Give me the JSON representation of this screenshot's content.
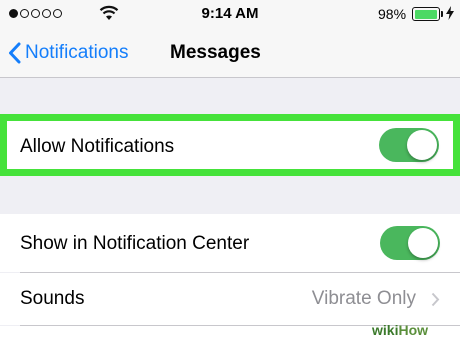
{
  "status_bar": {
    "signal_bars": 5,
    "signal_filled": 1,
    "time": "9:14 AM",
    "battery_percent": "98%",
    "battery_level": 0.98,
    "battery_color": "#4cd964"
  },
  "nav": {
    "back_label": "Notifications",
    "title": "Messages",
    "accent_color": "#147efb"
  },
  "settings": {
    "allow_notifications": {
      "label": "Allow Notifications",
      "enabled": true
    },
    "show_in_center": {
      "label": "Show in Notification Center",
      "enabled": true
    },
    "sounds": {
      "label": "Sounds",
      "value": "Vibrate Only"
    }
  },
  "highlight_color": "#45e23a",
  "toggle_on_color": "#4ab75d",
  "watermark": {
    "wiki": "wiki",
    "how": "How"
  }
}
